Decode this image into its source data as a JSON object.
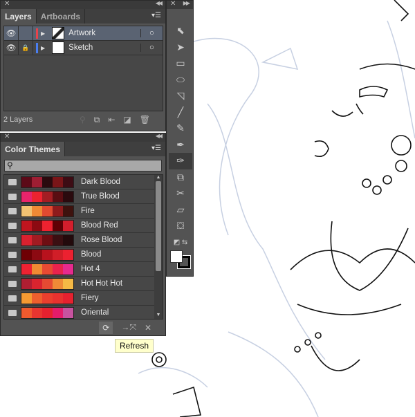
{
  "layers_panel": {
    "tabs": [
      "Layers",
      "Artboards"
    ],
    "active_tab": "Layers",
    "layers": [
      {
        "name": "Artwork",
        "color": "#e8434b",
        "visible": true,
        "locked": false,
        "selected": true
      },
      {
        "name": "Sketch",
        "color": "#4a7ef0",
        "visible": true,
        "locked": true,
        "selected": false
      }
    ],
    "count_label": "2 Layers"
  },
  "themes_panel": {
    "title": "Color Themes",
    "search_placeholder": "",
    "themes": [
      {
        "name": "Dark Blood",
        "colors": [
          "#5c0a18",
          "#9e1e33",
          "#2a0a0e",
          "#7a1518",
          "#3d0c14"
        ]
      },
      {
        "name": "True Blood",
        "colors": [
          "#e8246b",
          "#ed2330",
          "#a31d23",
          "#5a0d12",
          "#2a0a0e"
        ]
      },
      {
        "name": "Fire",
        "colors": [
          "#f2c272",
          "#ef8a35",
          "#e14a30",
          "#8e1b1c",
          "#3e120e"
        ]
      },
      {
        "name": "Blood Red",
        "colors": [
          "#c0151f",
          "#8c0a12",
          "#ed2230",
          "#600005",
          "#d41e2c"
        ]
      },
      {
        "name": "Rose Blood",
        "colors": [
          "#d9212f",
          "#a11b22",
          "#6e0e13",
          "#3b0f12",
          "#230a0c"
        ]
      },
      {
        "name": "Blood",
        "colors": [
          "#6e0004",
          "#8c0a12",
          "#b8121d",
          "#d11e28",
          "#ec2130"
        ]
      },
      {
        "name": "Hot 4",
        "colors": [
          "#ed2232",
          "#f08a33",
          "#e84a33",
          "#e8234d",
          "#e62a8e"
        ]
      },
      {
        "name": "Hot Hot Hot",
        "colors": [
          "#b01e32",
          "#d9242f",
          "#e54a33",
          "#ef8a37",
          "#f5b945"
        ]
      },
      {
        "name": "Fiery",
        "colors": [
          "#f59a32",
          "#ee5f2e",
          "#ea3f2e",
          "#e8322f",
          "#e6212f"
        ]
      },
      {
        "name": "Oriental",
        "colors": [
          "#ef5a2e",
          "#e83530",
          "#e6212f",
          "#e41c6a",
          "#c7539f"
        ]
      }
    ]
  },
  "tooltip": "Refresh"
}
